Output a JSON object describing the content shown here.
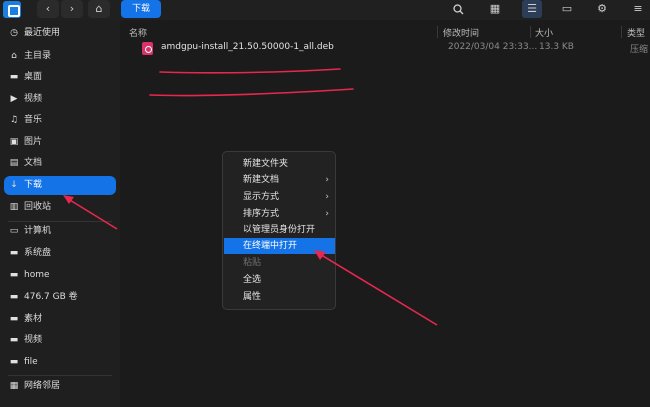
{
  "toolbar": {
    "app_icon": "file-manager-icon",
    "back_glyph": "‹",
    "forward_glyph": "›",
    "home_glyph": "⌂",
    "breadcrumb": "下载",
    "search_glyph": "⚲",
    "grid_glyph": "▦",
    "list_glyph": "☰",
    "details_glyph": "▭",
    "settings_glyph": "⚙",
    "menu_glyph": "≡"
  },
  "window_buttons": {
    "minimize": "—",
    "close": "✕"
  },
  "sidebar": {
    "items": [
      {
        "icon": "clock-icon",
        "glyph": "◷",
        "label": "最近使用"
      },
      {
        "icon": "home-icon",
        "glyph": "⌂",
        "label": "主目录"
      },
      {
        "icon": "desktop-icon",
        "glyph": "▬",
        "label": "桌面"
      },
      {
        "icon": "video-icon",
        "glyph": "▶",
        "label": "视频"
      },
      {
        "icon": "music-icon",
        "glyph": "♫",
        "label": "音乐"
      },
      {
        "icon": "picture-icon",
        "glyph": "▣",
        "label": "图片"
      },
      {
        "icon": "document-icon",
        "glyph": "▤",
        "label": "文档"
      },
      {
        "icon": "download-icon",
        "glyph": "↓",
        "label": "下载"
      },
      {
        "icon": "trash-icon",
        "glyph": "▥",
        "label": "回收站"
      },
      {
        "icon": "computer-icon",
        "glyph": "▭",
        "label": "计算机"
      },
      {
        "icon": "disk-icon",
        "glyph": "▬",
        "label": "系统盘"
      },
      {
        "icon": "disk-icon",
        "glyph": "▬",
        "label": "home"
      },
      {
        "icon": "disk-icon",
        "glyph": "▬",
        "label": "476.7 GB 卷"
      },
      {
        "icon": "disk-icon",
        "glyph": "▬",
        "label": "素材"
      },
      {
        "icon": "disk-icon",
        "glyph": "▬",
        "label": "视频"
      },
      {
        "icon": "disk-icon",
        "glyph": "▬",
        "label": "file"
      },
      {
        "icon": "network-icon",
        "glyph": "▦",
        "label": "网络邻居"
      }
    ],
    "selected_index": 7
  },
  "columns": {
    "name": "名称",
    "modified": "修改时间",
    "size": "大小",
    "type": "类型"
  },
  "files": [
    {
      "icon": "deb-package-icon",
      "name": "amdgpu-install_21.50.50000-1_all.deb",
      "modified": "2022/03/04 23:33...",
      "size": "13.3 KB",
      "type": "压缩"
    }
  ],
  "context_menu": {
    "items": [
      {
        "label": "新建文件夹",
        "submenu": false,
        "state": "normal"
      },
      {
        "label": "新建文档",
        "submenu": true,
        "state": "normal"
      },
      {
        "label": "显示方式",
        "submenu": true,
        "state": "normal"
      },
      {
        "label": "排序方式",
        "submenu": true,
        "state": "normal"
      },
      {
        "label": "以管理员身份打开",
        "submenu": false,
        "state": "normal"
      },
      {
        "label": "在终端中打开",
        "submenu": false,
        "state": "highlighted"
      },
      {
        "label": "粘贴",
        "submenu": false,
        "state": "disabled"
      },
      {
        "label": "全选",
        "submenu": false,
        "state": "normal"
      },
      {
        "label": "属性",
        "submenu": false,
        "state": "normal"
      }
    ],
    "submenu_glyph": "›"
  },
  "annotations": {
    "color": "#e8274f"
  }
}
